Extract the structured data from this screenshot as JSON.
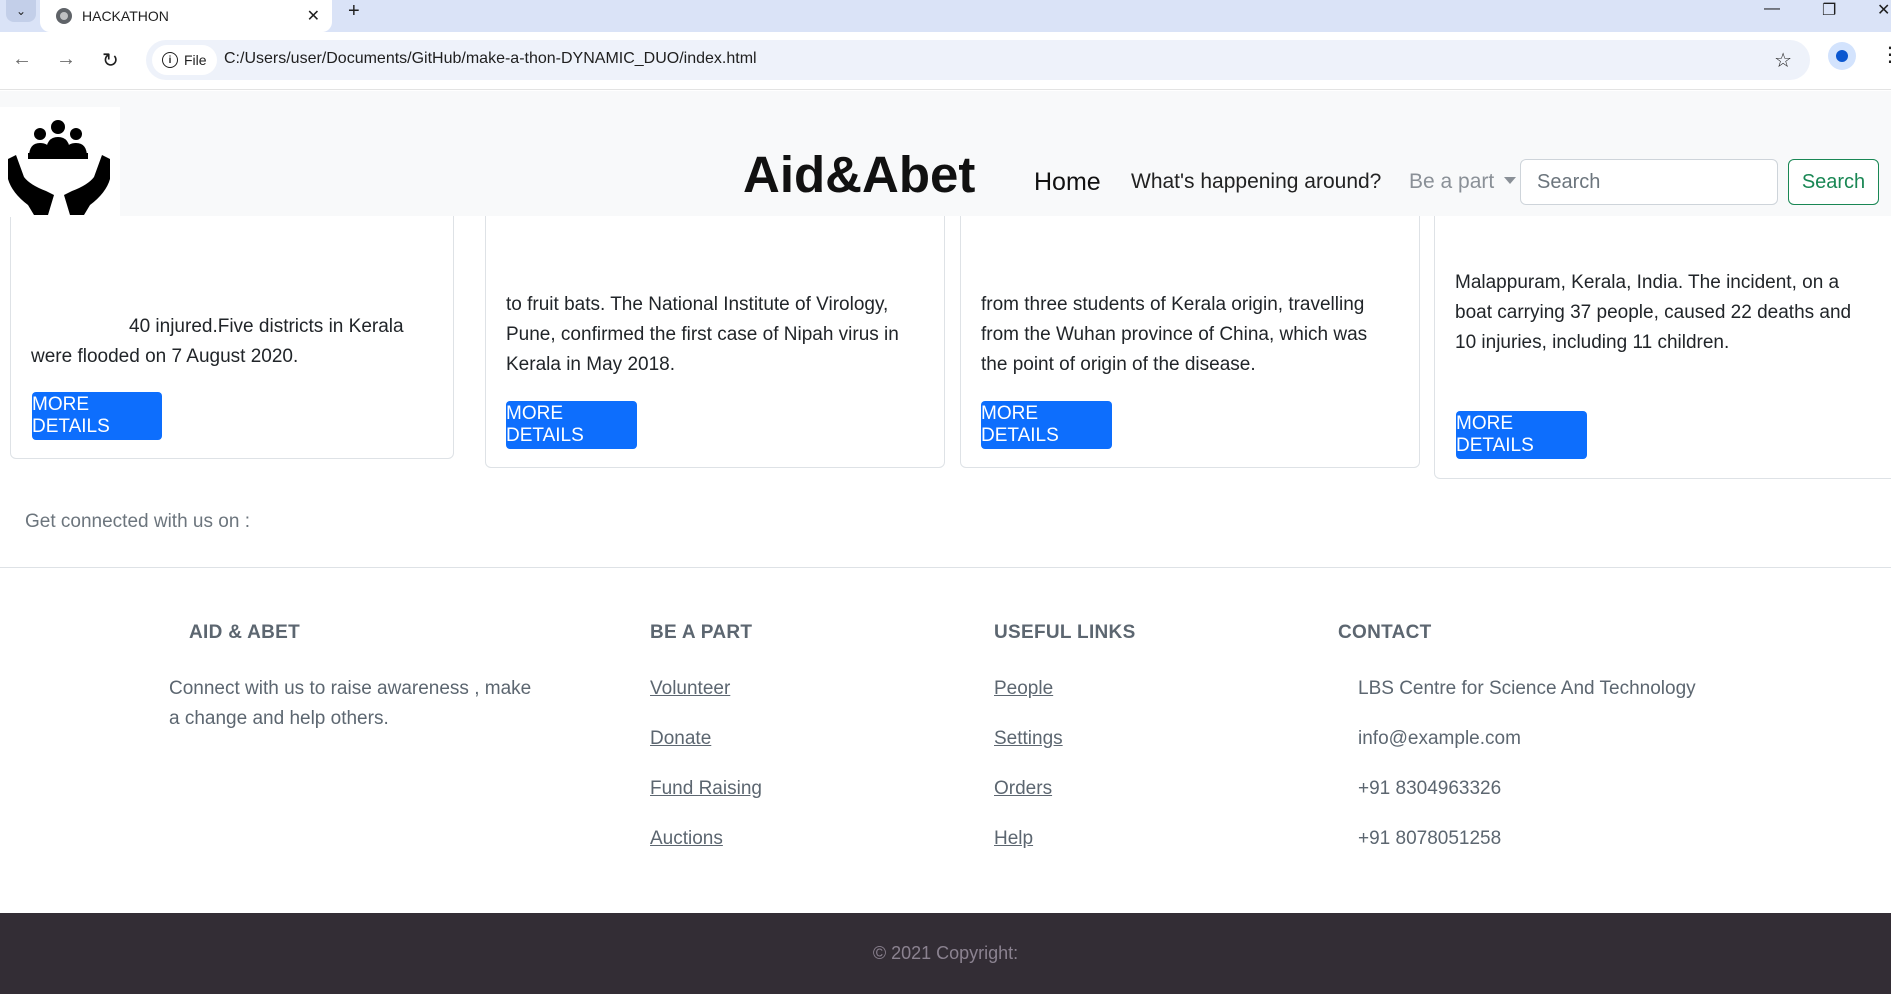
{
  "browser": {
    "tab_title": "HACKATHON",
    "url_chip": "File",
    "url": "C:/Users/user/Documents/GitHub/make-a-thon-DYNAMIC_DUO/index.html"
  },
  "navbar": {
    "brand": "Aid&Abet",
    "home": "Home",
    "happening": "What's happening around?",
    "be_a_part": "Be a part",
    "search_placeholder": "Search",
    "search_button": "Search"
  },
  "cards": [
    {
      "lines": [
        "40 injured.Five districts in Kerala",
        "were flooded on 7 August 2020."
      ],
      "button": "MORE DETAILS"
    },
    {
      "lines": [
        "to fruit bats. The National Institute of Virology,",
        "Pune, confirmed the first case of Nipah virus in",
        "Kerala in May 2018."
      ],
      "button": "MORE DETAILS"
    },
    {
      "lines": [
        "from three students of Kerala origin, travelling",
        "from the Wuhan province of China, which was",
        "the point of origin of the disease."
      ],
      "button": "MORE DETAILS"
    },
    {
      "lines": [
        "Malappuram, Kerala, India. The incident, on a",
        "boat carrying 37 people, caused 22 deaths and",
        "10 injuries, including 11 children."
      ],
      "button": "MORE DETAILS"
    }
  ],
  "connected_text": "Get connected with us on :",
  "footer": {
    "about": {
      "heading": "AID & ABET",
      "lines": [
        "Connect with us to raise awareness , make",
        "a change and help others."
      ]
    },
    "be_a_part": {
      "heading": "BE A PART",
      "links": [
        "Volunteer",
        "Donate",
        "Fund Raising",
        "Auctions"
      ]
    },
    "useful_links": {
      "heading": "USEFUL LINKS",
      "links": [
        "People",
        "Settings",
        "Orders",
        "Help"
      ]
    },
    "contact": {
      "heading": "CONTACT",
      "items": [
        "LBS Centre for Science And Technology",
        "info@example.com",
        "+91 8304963326",
        "+91 8078051258"
      ]
    }
  },
  "copyright": "© 2021 Copyright:",
  "colors": {
    "primary": "#0d6efd",
    "success": "#198754",
    "footer_bar": "#332d35",
    "tab_strip": "#dae3f7"
  },
  "icons": [
    "chevron-down-icon",
    "globe-icon",
    "close-icon",
    "plus-icon",
    "minimize-icon",
    "restore-icon",
    "back-icon",
    "forward-icon",
    "reload-icon",
    "info-icon",
    "star-icon",
    "profile-icon",
    "kebab-icon",
    "helping-hands-logo-icon"
  ]
}
